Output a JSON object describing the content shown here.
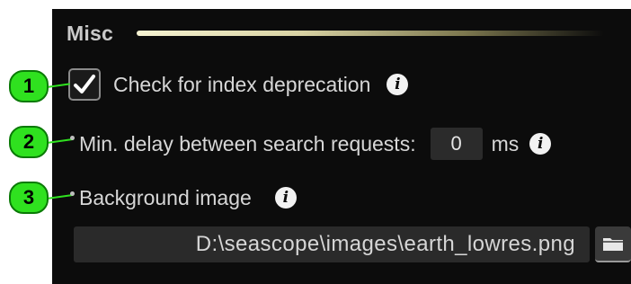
{
  "section": {
    "title": "Misc"
  },
  "options": {
    "index_deprecation": {
      "checked": true,
      "label": "Check for index deprecation"
    },
    "search_delay": {
      "label": "Min. delay between search requests:",
      "value": "0",
      "unit": "ms"
    },
    "background_image": {
      "label": "Background image",
      "path": "D:\\seascope\\images\\earth_lowres.png"
    }
  },
  "callouts": [
    "1",
    "2",
    "3"
  ],
  "icons": {
    "info": "info-icon",
    "checkmark": "checkmark-icon",
    "folder": "folder-icon"
  },
  "colors": {
    "panel_bg": "#0c0c0c",
    "callout_fill": "#2fe11f",
    "text": "#d7d7d7",
    "field_bg": "#2a2a2a"
  }
}
